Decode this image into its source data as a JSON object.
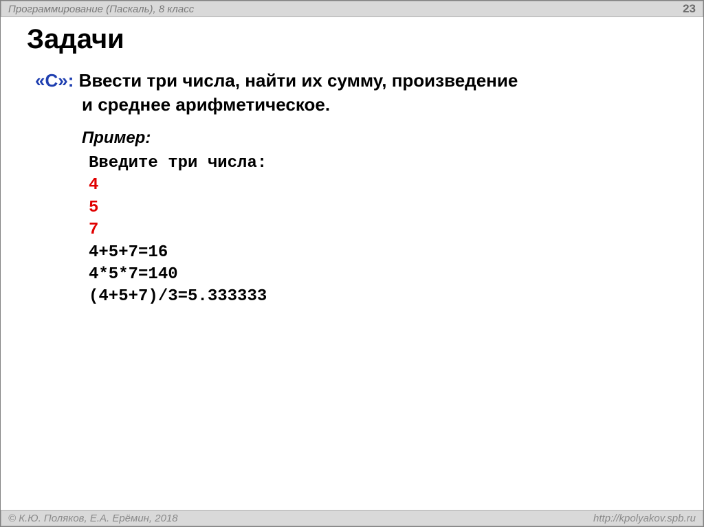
{
  "header": {
    "course": "Программирование (Паскаль), 8 класс",
    "page": "23"
  },
  "title": "Задачи",
  "task": {
    "marker": "«C»:",
    "line1": " Ввести три числа, найти их сумму, произведение",
    "line2": "и среднее арифметическое."
  },
  "example": {
    "label": "Пример:",
    "lines": {
      "prompt": "Введите три числа:",
      "n1": "4",
      "n2": "5",
      "n3": "7",
      "sum": "4+5+7=16",
      "product": "4*5*7=140",
      "avg": "(4+5+7)/3=5.333333"
    }
  },
  "footer": {
    "copyright": "© К.Ю. Поляков, Е.А. Ерёмин, 2018",
    "url": "http://kpolyakov.spb.ru"
  }
}
